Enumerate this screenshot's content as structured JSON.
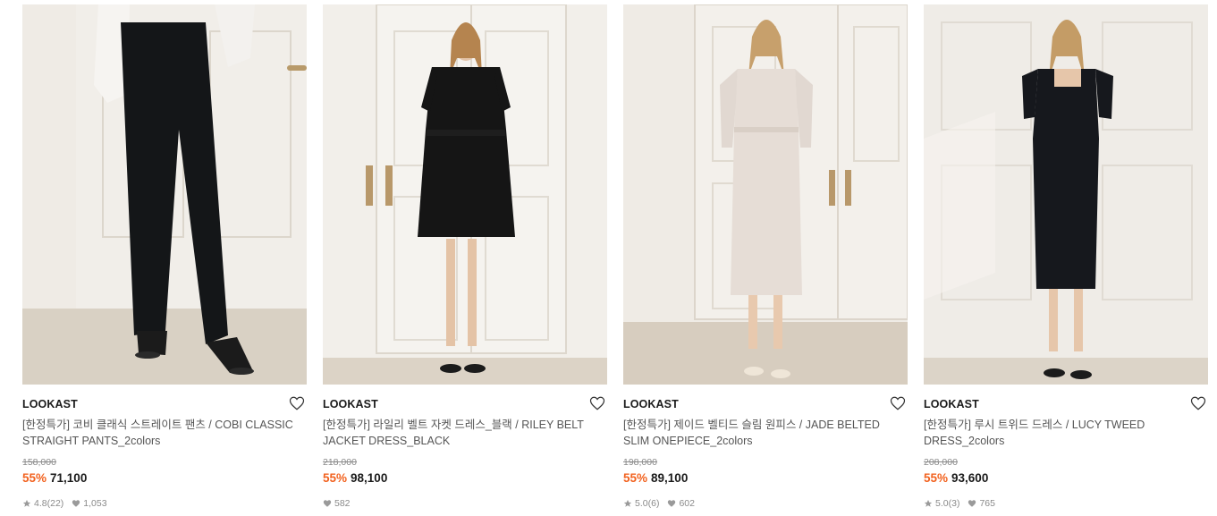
{
  "colors": {
    "discount": "#f2621f",
    "brand": "#1a1a1a",
    "muted": "#8a8a8a"
  },
  "products": [
    {
      "brand": "LOOKAST",
      "name": "[한정특가] 코비 클래식 스트레이트 팬츠 / COBI CLASSIC STRAIGHT PANTS_2colors",
      "original_price": "158,000",
      "discount": "55%",
      "price": "71,100",
      "rating": "4.8",
      "reviews": "(22)",
      "likes": "1,053",
      "image": "black straight pants with strappy sandals"
    },
    {
      "brand": "LOOKAST",
      "name": "[한정특가] 라일리 벨트 자켓 드레스_블랙 / RILEY BELT JACKET DRESS_BLACK",
      "original_price": "218,000",
      "discount": "55%",
      "price": "98,100",
      "rating": "",
      "reviews": "",
      "likes": "582",
      "image": "model in black belted jacket dress"
    },
    {
      "brand": "LOOKAST",
      "name": "[한정특가] 제이드 벨티드 슬림 원피스 / JADE BELTED SLIM ONEPIECE_2colors",
      "original_price": "198,000",
      "discount": "55%",
      "price": "89,100",
      "rating": "5.0",
      "reviews": "(6)",
      "likes": "602",
      "image": "model in light pink belted slim dress"
    },
    {
      "brand": "LOOKAST",
      "name": "[한정특가] 루시 트위드 드레스 / LUCY TWEED DRESS_2colors",
      "original_price": "208,000",
      "discount": "55%",
      "price": "93,600",
      "rating": "5.0",
      "reviews": "(3)",
      "likes": "765",
      "image": "model in black tweed dress"
    }
  ],
  "icons": {
    "wishlist": "heart-outline-icon",
    "rating": "star-icon",
    "likes": "heart-filled-icon"
  }
}
